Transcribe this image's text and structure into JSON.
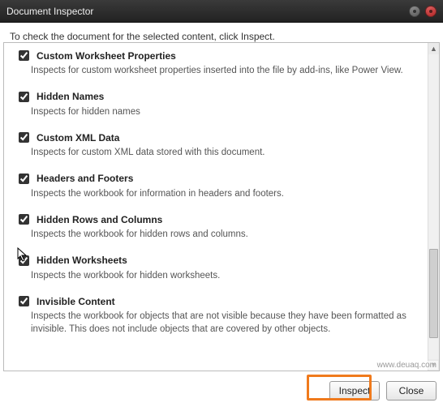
{
  "window": {
    "title": "Document Inspector"
  },
  "instruction": "To check the document for the selected content, click Inspect.",
  "items": [
    {
      "title": "Custom Worksheet Properties",
      "desc": "Inspects for custom worksheet properties inserted into the file by add-ins, like Power View."
    },
    {
      "title": "Hidden Names",
      "desc": "Inspects for hidden names"
    },
    {
      "title": "Custom XML Data",
      "desc": "Inspects for custom XML data stored with this document."
    },
    {
      "title": "Headers and Footers",
      "desc": "Inspects the workbook for information in headers and footers."
    },
    {
      "title": "Hidden Rows and Columns",
      "desc": "Inspects the workbook for hidden rows and columns."
    },
    {
      "title": "Hidden Worksheets",
      "desc": "Inspects the workbook for hidden worksheets."
    },
    {
      "title": "Invisible Content",
      "desc": "Inspects the workbook for objects that are not visible because they have been formatted as invisible. This does not include objects that are covered by other objects."
    }
  ],
  "buttons": {
    "inspect": "Inspect",
    "close": "Close"
  },
  "watermark": "www.deuaq.com"
}
